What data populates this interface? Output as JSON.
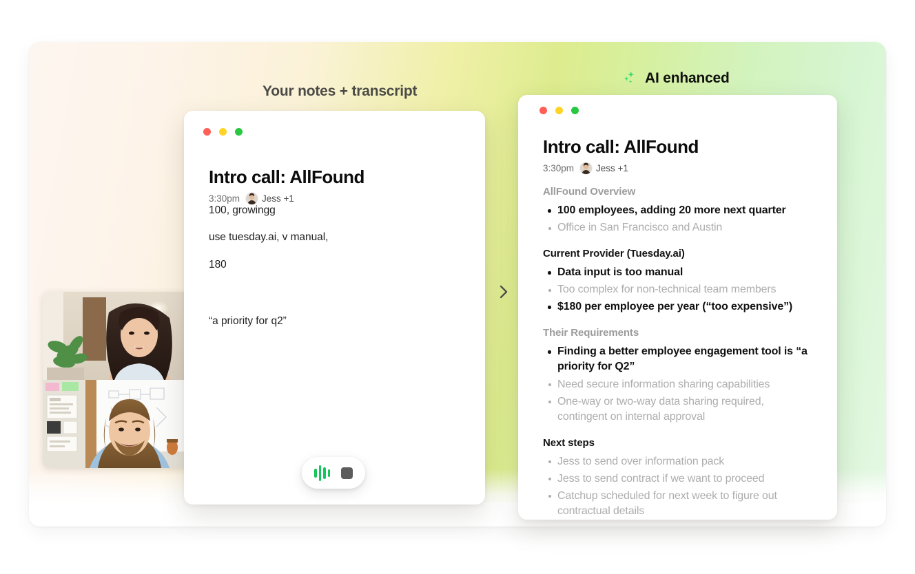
{
  "stage": {
    "gradient_start": "#fdf6f0",
    "gradient_mid": "#ddec8e",
    "gradient_end": "#e4f8e3"
  },
  "captions": {
    "left": "Your notes + transcript",
    "right": "AI enhanced",
    "right_icon": "sparkles-icon",
    "right_icon_color": "#3ddc6e"
  },
  "chevron": {
    "icon": "chevron-right-icon"
  },
  "video": {
    "tile_top_label": "participant-video-top",
    "tile_bottom_label": "participant-video-bottom"
  },
  "window_controls": {
    "red": "#ff5f57",
    "yellow": "#ffd426",
    "green": "#28c840"
  },
  "notes": {
    "title": "Intro call: AllFound",
    "time": "3:30pm",
    "attendees": "Jess +1",
    "lines": [
      "100, growingg",
      "use tuesday.ai, v manual,",
      "180",
      "“a priority for q2”"
    ],
    "recorder": {
      "waveform_icon": "audio-waveform-icon",
      "waveform_color": "#15c55e",
      "stop_icon": "stop-recording-icon",
      "stop_color": "#5c5c5c"
    }
  },
  "ai": {
    "title": "Intro call: AllFound",
    "time": "3:30pm",
    "attendees": "Jess +1",
    "sections": [
      {
        "heading": "AllFound Overview",
        "heading_style": "muted",
        "items": [
          {
            "text": "100 employees, adding 20 more next quarter",
            "style": "strong"
          },
          {
            "text": "Office in San Francisco and Austin",
            "style": "faint"
          }
        ]
      },
      {
        "heading": "Current Provider (Tuesday.ai)",
        "heading_style": "dark",
        "items": [
          {
            "text": "Data input is too manual",
            "style": "strong"
          },
          {
            "text": "Too complex for non-technical team members",
            "style": "faint"
          },
          {
            "text": "$180 per employee per year (“too expensive”)",
            "style": "strong"
          }
        ]
      },
      {
        "heading": "Their Requirements",
        "heading_style": "muted",
        "items": [
          {
            "text": "Finding a better employee engagement tool is “a priority for Q2”",
            "style": "strong"
          },
          {
            "text": "Need secure information sharing capabilities",
            "style": "faint"
          },
          {
            "text": "One-way or two-way data sharing required, contingent on internal approval",
            "style": "faint"
          }
        ]
      },
      {
        "heading": "Next steps",
        "heading_style": "dark",
        "items": [
          {
            "text": "Jess to send over information pack",
            "style": "faint"
          },
          {
            "text": "Jess to send contract if we want to proceed",
            "style": "faint"
          },
          {
            "text": "Catchup scheduled for next week to figure out contractual details",
            "style": "faint"
          }
        ]
      }
    ]
  }
}
